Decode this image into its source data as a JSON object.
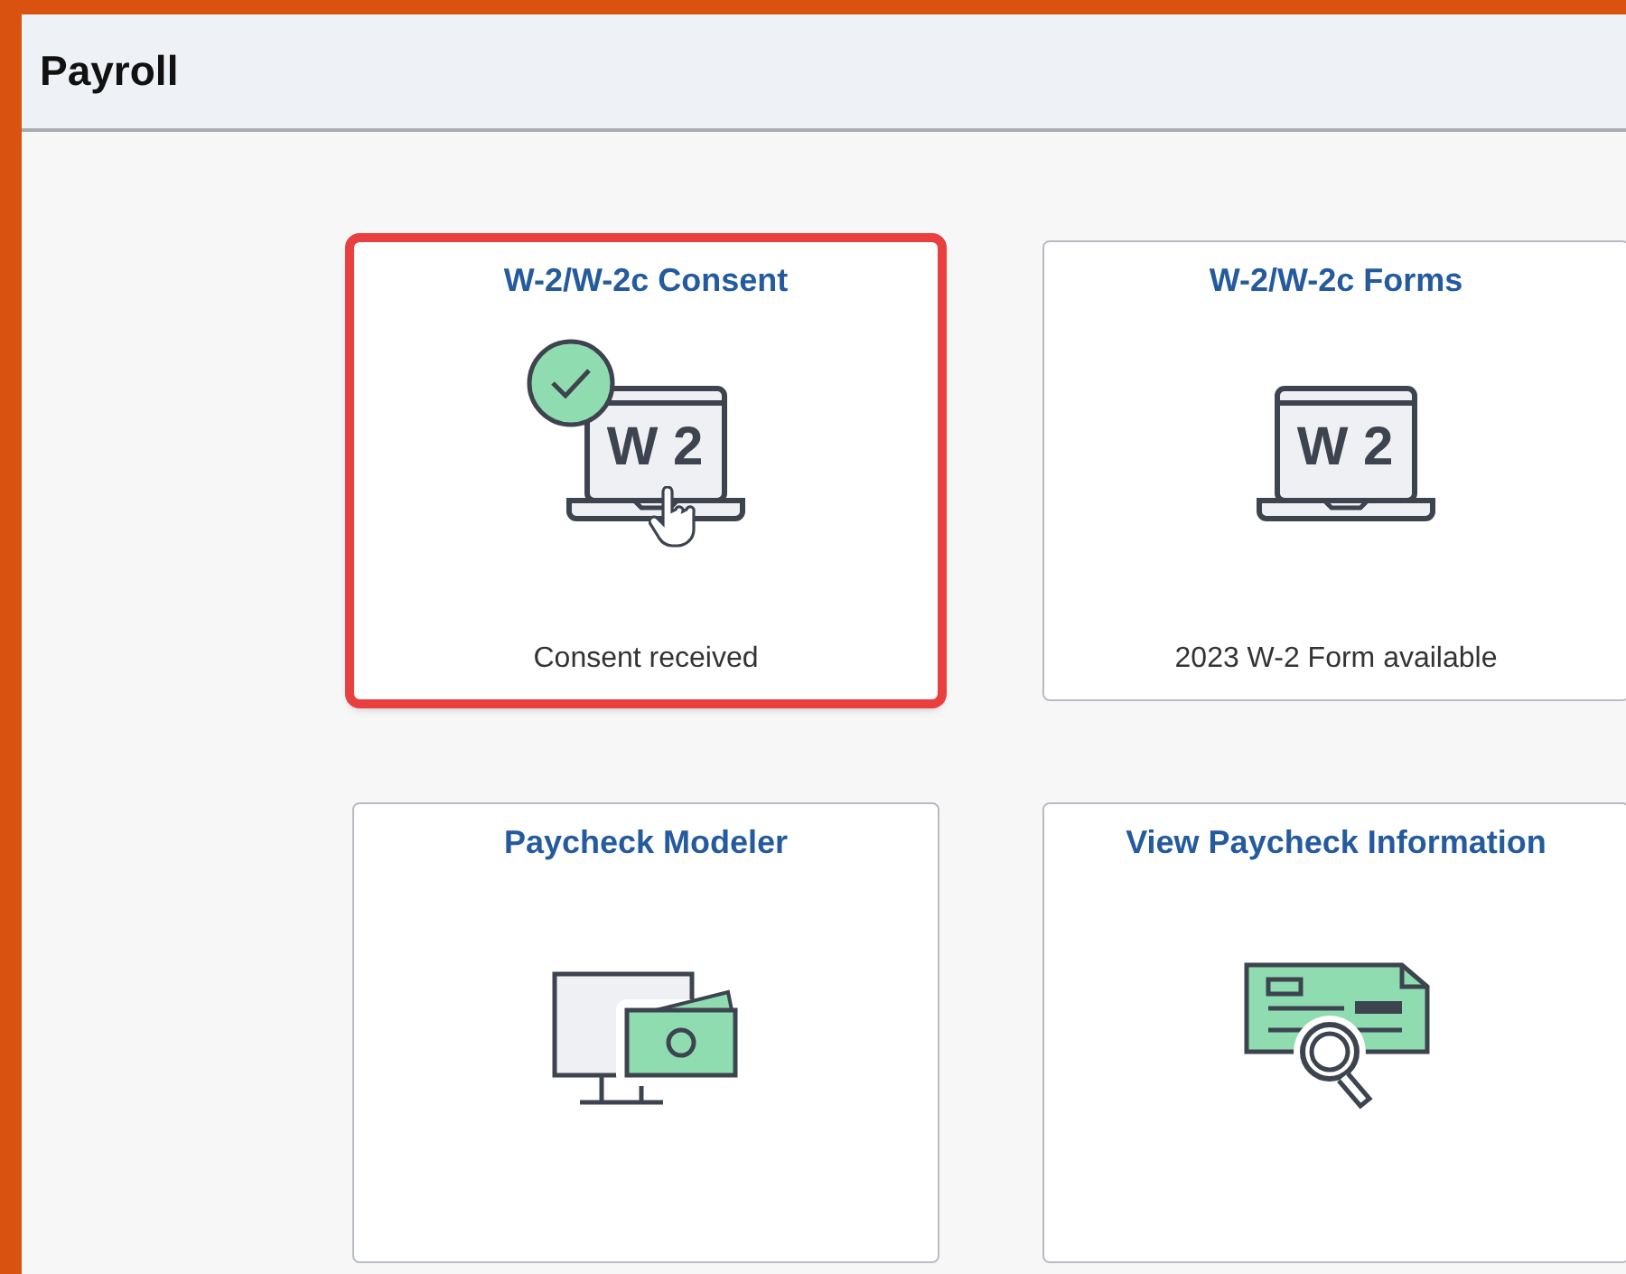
{
  "page": {
    "title": "Payroll"
  },
  "tiles": [
    {
      "title": "W-2/W-2c Consent",
      "kind": "consent",
      "icon_text": "W 2",
      "status": "Consent received",
      "highlighted": true
    },
    {
      "title": "W-2/W-2c Forms",
      "kind": "forms",
      "icon_text": "W 2",
      "status": "2023 W-2 Form available",
      "highlighted": false
    },
    {
      "title": "Paycheck Modeler",
      "kind": "modeler",
      "highlighted": false
    },
    {
      "title": "View Paycheck Information",
      "kind": "paycheck",
      "highlighted": false
    }
  ]
}
